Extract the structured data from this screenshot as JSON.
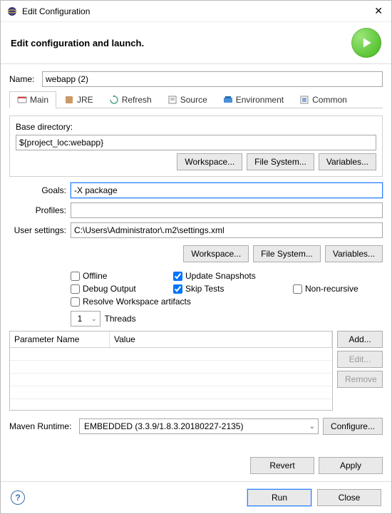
{
  "window": {
    "title": "Edit Configuration",
    "subtitle": "Edit configuration and launch."
  },
  "name": {
    "label": "Name:",
    "value": "webapp (2)"
  },
  "tabs": [
    "Main",
    "JRE",
    "Refresh",
    "Source",
    "Environment",
    "Common"
  ],
  "main": {
    "base_dir_label": "Base directory:",
    "base_dir_value": "${project_loc:webapp}",
    "btn_workspace": "Workspace...",
    "btn_filesystem": "File System...",
    "btn_variables": "Variables...",
    "goals_label": "Goals:",
    "goals_value": "-X package",
    "profiles_label": "Profiles:",
    "profiles_value": "",
    "usersettings_label": "User settings:",
    "usersettings_value": "C:\\Users\\Administrator\\.m2\\settings.xml",
    "checks": {
      "offline": {
        "label": "Offline",
        "checked": false
      },
      "update_snapshots": {
        "label": "Update Snapshots",
        "checked": true
      },
      "debug_output": {
        "label": "Debug Output",
        "checked": false
      },
      "skip_tests": {
        "label": "Skip Tests",
        "checked": true
      },
      "non_recursive": {
        "label": "Non-recursive",
        "checked": false
      },
      "resolve_ws": {
        "label": "Resolve Workspace artifacts",
        "checked": false
      }
    },
    "threads_value": "1",
    "threads_label": "Threads",
    "table": {
      "col_name": "Parameter Name",
      "col_value": "Value",
      "btn_add": "Add...",
      "btn_edit": "Edit...",
      "btn_remove": "Remove"
    },
    "runtime_label": "Maven Runtime:",
    "runtime_value": "EMBEDDED (3.3.9/1.8.3.20180227-2135)",
    "btn_configure": "Configure..."
  },
  "footer": {
    "revert": "Revert",
    "apply": "Apply",
    "run": "Run",
    "close": "Close"
  }
}
